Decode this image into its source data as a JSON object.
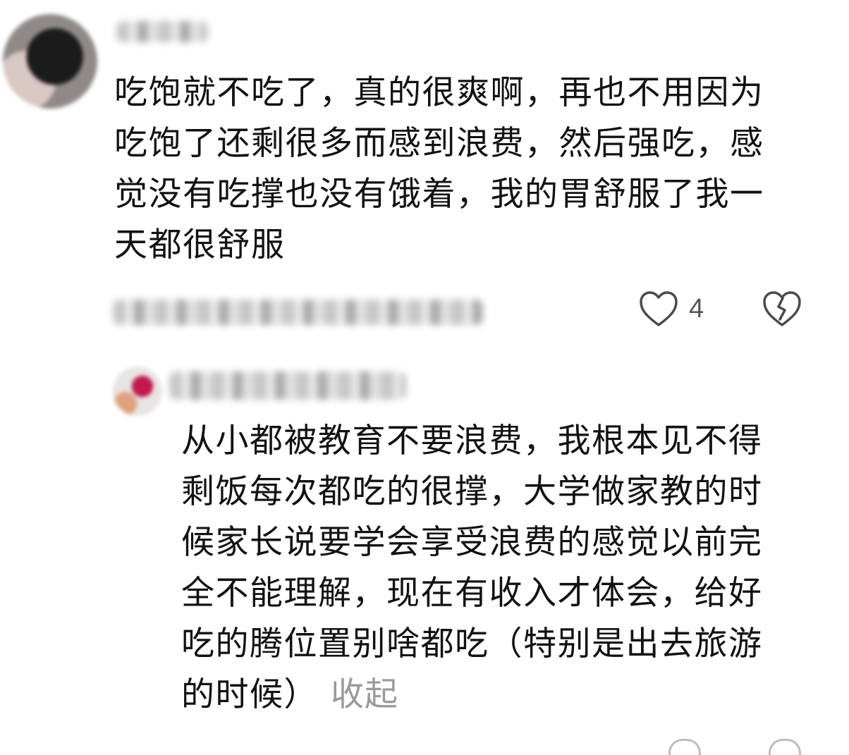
{
  "main_comment": {
    "text": "吃饱就不吃了，真的很爽啊，再也不用因为\n吃饱了还剩很多而感到浪费，然后强吃，感\n觉没有吃撑也没有饿着，我的胃舒服了我一\n天都很舒服",
    "like_count": "4",
    "icons": {
      "like": "heart-outline-icon",
      "dislike": "broken-heart-icon"
    }
  },
  "reply_comment": {
    "text": "从小都被教育不要浪费，我根本见不得\n剩饭每次都吃的很撑，大学做家教的时\n候家长说要学会享受浪费的感觉以前完\n全不能理解，现在有收入才体会，给好\n吃的腾位置别啥都吃（特别是出去旅游\n的时候）",
    "collapse_label": "收起"
  },
  "colors": {
    "text": "#121212",
    "muted": "#9a9a9a",
    "icon": "#4a4a4a"
  }
}
